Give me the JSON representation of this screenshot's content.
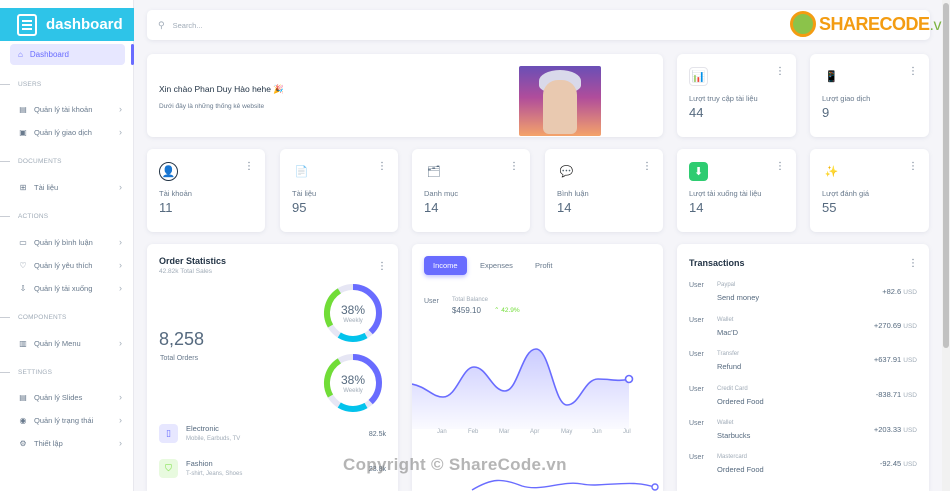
{
  "sidebar": {
    "brand": "dashboard",
    "active_item": "Dashboard",
    "sections": {
      "users": "USERS",
      "documents": "DOCUMENTS",
      "actions": "ACTIONS",
      "components": "COMPONENTS",
      "settings": "SETTINGS"
    },
    "items": {
      "accounts": "Quản lý tài khoản",
      "transactions": "Quản lý giao dịch",
      "documents": "Tài liệu",
      "comments": "Quản lý bình luận",
      "likes": "Quản lý yêu thích",
      "downloads": "Quản lý tải xuống",
      "menu": "Quản lý Menu",
      "slides": "Quản lý Slides",
      "status": "Quản lý trạng thái",
      "setup": "Thiết lập"
    }
  },
  "search": {
    "placeholder": "Search..."
  },
  "logo": {
    "brand": "SHARECODE",
    "tld": ".vn"
  },
  "welcome": {
    "title": "Xin chào Phan Duy Hào hehe 🎉",
    "subtitle": "Dưới đây là những thống kê website"
  },
  "stats_top": [
    {
      "label": "Lượt truy cập tài liệu",
      "value": "44"
    },
    {
      "label": "Lượt giao dịch",
      "value": "9"
    }
  ],
  "stats_row": [
    {
      "label": "Tài khoản",
      "value": "11"
    },
    {
      "label": "Tài liệu",
      "value": "95"
    },
    {
      "label": "Danh mục",
      "value": "14"
    },
    {
      "label": "Bình luận",
      "value": "14"
    },
    {
      "label": "Lượt tải xuống tài liệu",
      "value": "14"
    },
    {
      "label": "Lượt đánh giá",
      "value": "55"
    }
  ],
  "order_stats": {
    "title": "Order Statistics",
    "subtitle": "42.82k Total Sales",
    "total": "8,258",
    "total_label": "Total Orders",
    "donuts": [
      {
        "pct": "38%",
        "label": "Weekly",
        "value": 38
      },
      {
        "pct": "38%",
        "label": "Weekly",
        "value": 38
      }
    ],
    "items": [
      {
        "name": "Electronic",
        "desc": "Mobile, Earbuds, TV",
        "value": "82.5k"
      },
      {
        "name": "Fashion",
        "desc": "T-shirt, Jeans, Shoes",
        "value": "23.8k"
      }
    ]
  },
  "income": {
    "tabs": [
      "Income",
      "Expenses",
      "Profit"
    ],
    "img_alt": "User",
    "balance_label": "Total Balance",
    "balance_value": "$459.10",
    "balance_change": "42.9%",
    "months": [
      "Jan",
      "Feb",
      "Mar",
      "Apr",
      "May",
      "Jun",
      "Jul"
    ]
  },
  "transactions": {
    "title": "Transactions",
    "img_alt": "User",
    "currency": "USD",
    "rows": [
      {
        "source": "Paypal",
        "name": "Send money",
        "amount": "+82.6"
      },
      {
        "source": "Wallet",
        "name": "Mac'D",
        "amount": "+270.69"
      },
      {
        "source": "Transfer",
        "name": "Refund",
        "amount": "+637.91"
      },
      {
        "source": "Credit Card",
        "name": "Ordered Food",
        "amount": "-838.71"
      },
      {
        "source": "Wallet",
        "name": "Starbucks",
        "amount": "+203.33"
      },
      {
        "source": "Mastercard",
        "name": "Ordered Food",
        "amount": "-92.45"
      }
    ]
  },
  "watermark": "Copyright © ShareCode.vn",
  "colors": {
    "primary": "#696cff",
    "brand": "#2ec4e8",
    "success": "#71dd37",
    "info": "#03c3ec"
  }
}
